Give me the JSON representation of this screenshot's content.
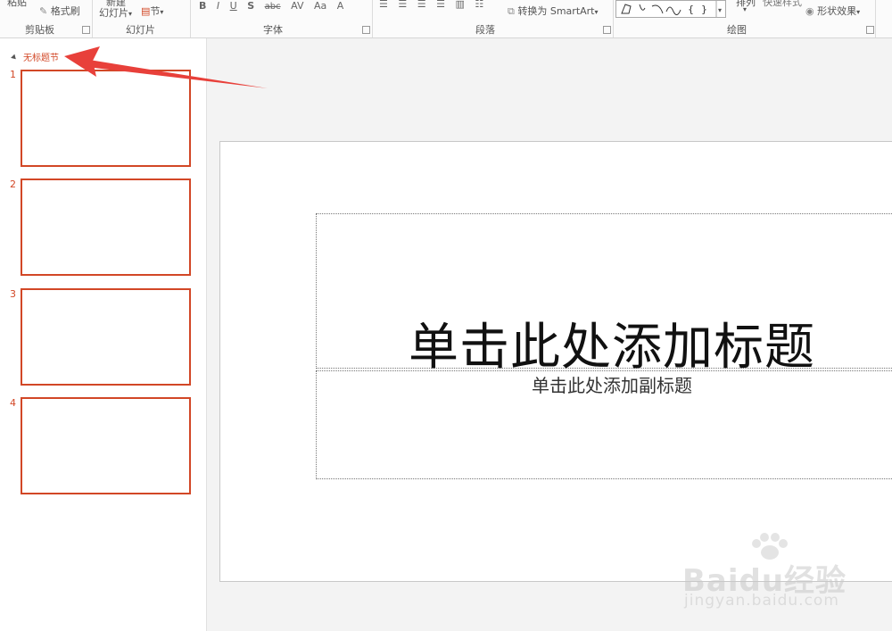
{
  "ribbon": {
    "clipboard": {
      "paste": "粘贴",
      "format_painter": "格式刷",
      "group": "剪贴板"
    },
    "slides": {
      "new_slide_1": "新建",
      "new_slide_2": "幻灯片",
      "section": "节",
      "group": "幻灯片"
    },
    "font": {
      "bold": "B",
      "italic": "I",
      "underline": "U",
      "shadow": "S",
      "strike": "abc",
      "spacing": "AV",
      "case": "Aa",
      "color": "A",
      "group": "字体"
    },
    "paragraph": {
      "smartart": "转换为 SmartArt",
      "group": "段落"
    },
    "drawing": {
      "arrange": "排列",
      "quick_styles": "快速样式",
      "shape_effects": "形状效果",
      "group": "绘图"
    }
  },
  "slide_pane": {
    "section_name": "无标题节",
    "thumbnails": [
      {
        "number": "1"
      },
      {
        "number": "2"
      },
      {
        "number": "3"
      },
      {
        "number": "4"
      }
    ]
  },
  "slide": {
    "title_placeholder": "单击此处添加标题",
    "subtitle_placeholder": "单击此处添加副标题"
  },
  "watermark": {
    "logo": "Baidu经验",
    "url": "jingyan.baidu.com"
  },
  "colors": {
    "accent": "#d24726",
    "arrow": "#e8403a"
  },
  "icons": [
    "format-painter-icon",
    "section-icon",
    "smartart-icon",
    "shape-effects-icon",
    "collapse-triangle-icon"
  ]
}
